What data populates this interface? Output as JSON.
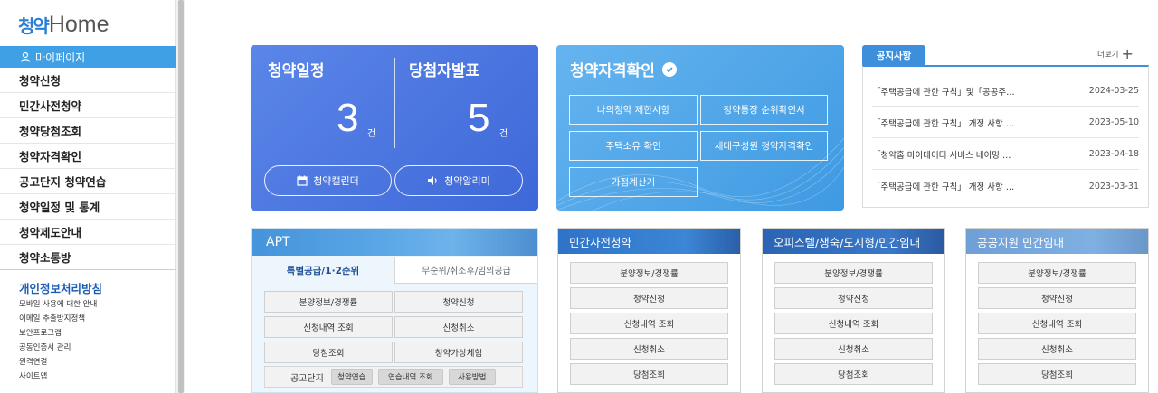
{
  "sidebar": {
    "logo_ko": "청약",
    "logo_en": "Home",
    "mypage": "마이페이지",
    "items": [
      {
        "label": "청약신청"
      },
      {
        "label": "민간사전청약"
      },
      {
        "label": "청약당첨조회"
      },
      {
        "label": "청약자격확인"
      },
      {
        "label": "공고단지 청약연습"
      },
      {
        "label": "청약일정 및 통계"
      },
      {
        "label": "청약제도안내"
      },
      {
        "label": "청약소통방"
      }
    ],
    "privacy": "개인정보처리방침",
    "sub_links": [
      "모바일 사용에 대한 안내",
      "이메일 추출방지정책",
      "보안프로그램",
      "공동인증서 관리",
      "원격연결",
      "사이트맵"
    ]
  },
  "schedule": {
    "title1": "청약일정",
    "title2": "당첨자발표",
    "count1": "3",
    "count2": "5",
    "unit": "건",
    "calendar_btn": "청약캘린더",
    "alarm_btn": "청약알리미"
  },
  "qualify": {
    "title": "청약자격확인",
    "buttons": [
      "나의청약 제한사항",
      "청약통장 순위확인서",
      "주택소유 확인",
      "세대구성원 청약자격확인",
      "가점계산기"
    ]
  },
  "notice": {
    "tab": "공지사항",
    "more": "더보기",
    "rows": [
      {
        "title": "「주택공급에 관한 규칙」및「공공주…",
        "date": "2024-03-25"
      },
      {
        "title": "「주택공급에 관한 규칙」 개정 사항 …",
        "date": "2023-05-10"
      },
      {
        "title": "「청약홈 마이데이터 서비스 네이밍 …",
        "date": "2023-04-18"
      },
      {
        "title": "「주택공급에 관한 규칙」 개정 사항 …",
        "date": "2023-03-31"
      }
    ]
  },
  "apt": {
    "title": "APT",
    "tab1": "특별공급/1·2순위",
    "tab2": "무순위/취소후/임의공급",
    "buttons": [
      "분양정보/경쟁률",
      "청약신청",
      "신청내역 조회",
      "신청취소",
      "당첨조회",
      "청약가상체험"
    ],
    "sim_label": "공고단지",
    "sim_buttons": [
      "청약연습",
      "연습내역 조회",
      "사용방법"
    ]
  },
  "private": {
    "title": "민간사전청약",
    "buttons": [
      "분양정보/경쟁률",
      "청약신청",
      "신청내역 조회",
      "신청취소",
      "당첨조회"
    ]
  },
  "office": {
    "title": "오피스텔/생숙/도시형/민간임대",
    "buttons": [
      "분양정보/경쟁률",
      "청약신청",
      "신청내역 조회",
      "신청취소",
      "당첨조회"
    ]
  },
  "public": {
    "title": "공공지원 민간임대",
    "buttons": [
      "분양정보/경쟁률",
      "청약신청",
      "신청내역 조회",
      "신청취소",
      "당첨조회"
    ]
  }
}
